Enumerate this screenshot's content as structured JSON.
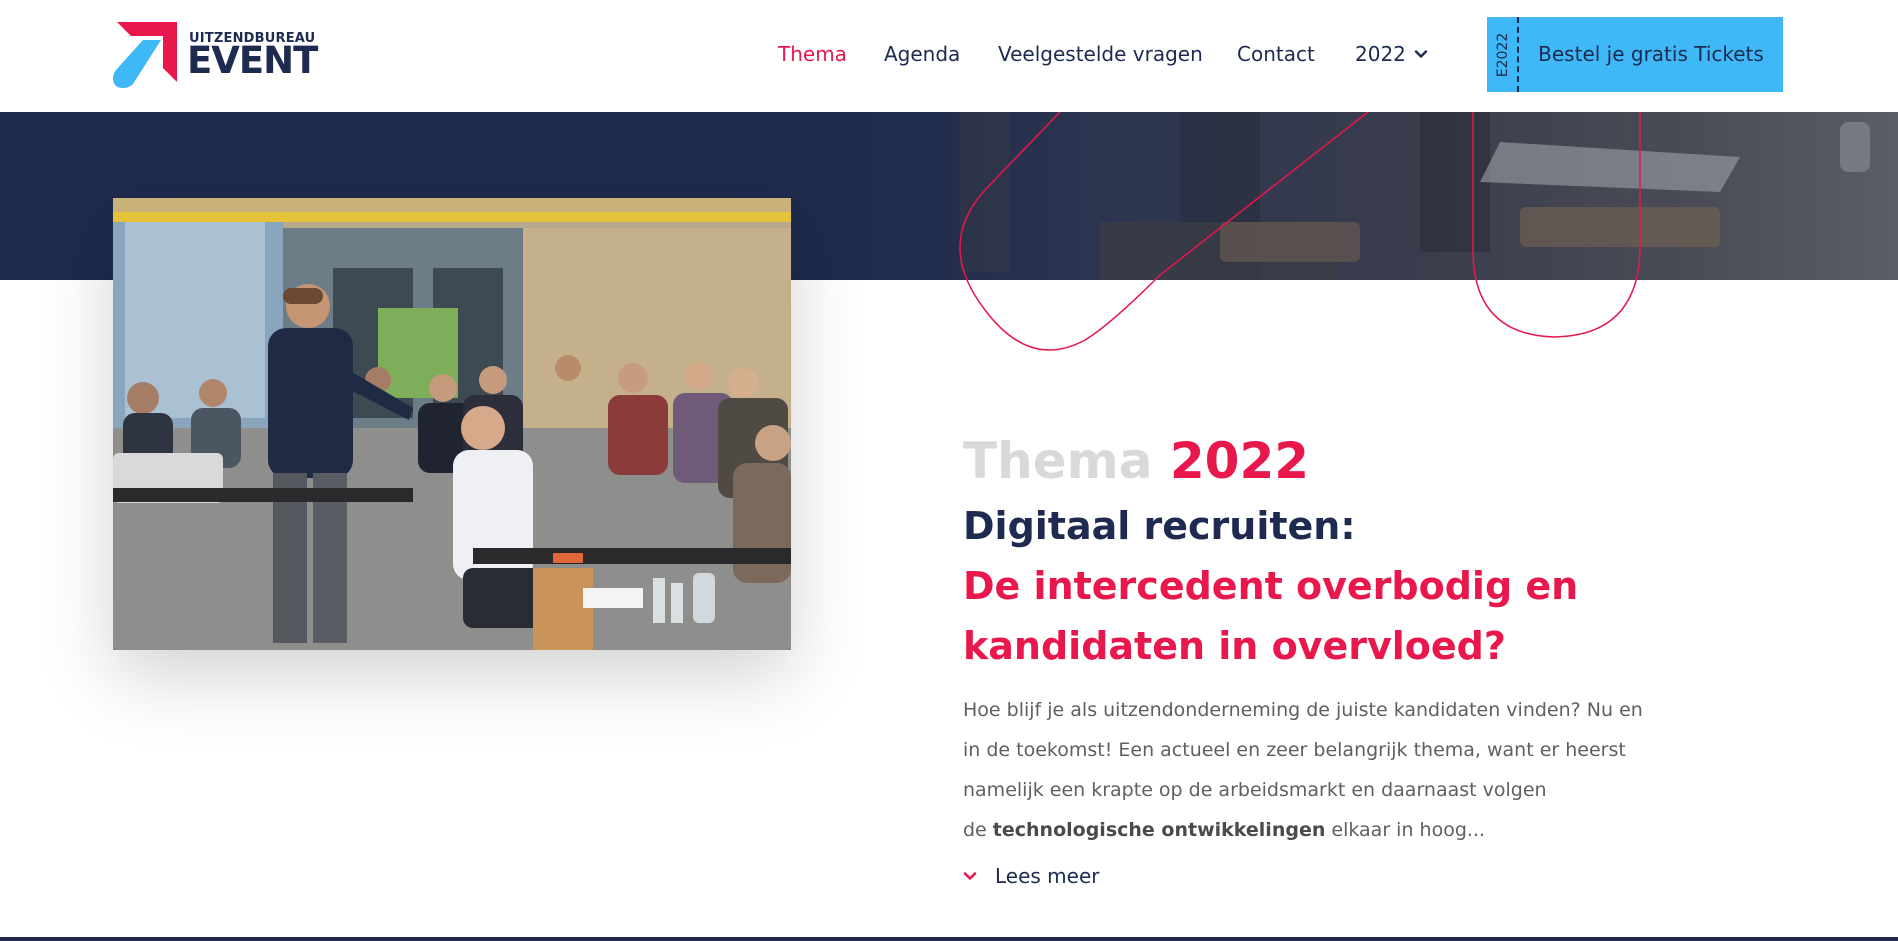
{
  "brand": {
    "logo_small": "UITZENDBUREAU",
    "logo_big": "EVENT",
    "colors": {
      "navy": "#1e2a4f",
      "pink": "#e8174c",
      "sky": "#3fb8f8"
    }
  },
  "nav": {
    "items": [
      {
        "label": "Thema",
        "active": true
      },
      {
        "label": "Agenda",
        "active": false
      },
      {
        "label": "Veelgestelde vragen",
        "active": false
      },
      {
        "label": "Contact",
        "active": false
      }
    ],
    "year_label": "2022",
    "year_icon": "chevron-down-icon"
  },
  "ticket": {
    "stub_label": "E2022",
    "label": "Bestel je gratis Tickets"
  },
  "hero": {
    "photo_alt_icon": "photo"
  },
  "content": {
    "kicker_grey": "Thema",
    "kicker_pink": "2022",
    "headline_dark": "Digitaal recruiten:",
    "headline_pink_line1": "De intercedent overbodig en",
    "headline_pink_line2": "kandidaten in overvloed?",
    "body_line1": "Hoe blijf je als uitzendonderneming de juiste kandidaten vinden? Nu en",
    "body_line2": "in de toekomst! Een actueel en zeer belangrijk thema, want er heerst",
    "body_line3": "namelijk een krapte op de arbeidsmarkt en daarnaast volgen",
    "body_line4_pre": "de ",
    "body_line4_bold": "technologische ontwikkelingen",
    "body_line4_post": " elkaar in hoog...",
    "more_label": "Lees meer",
    "more_icon": "chevron-down-icon"
  }
}
